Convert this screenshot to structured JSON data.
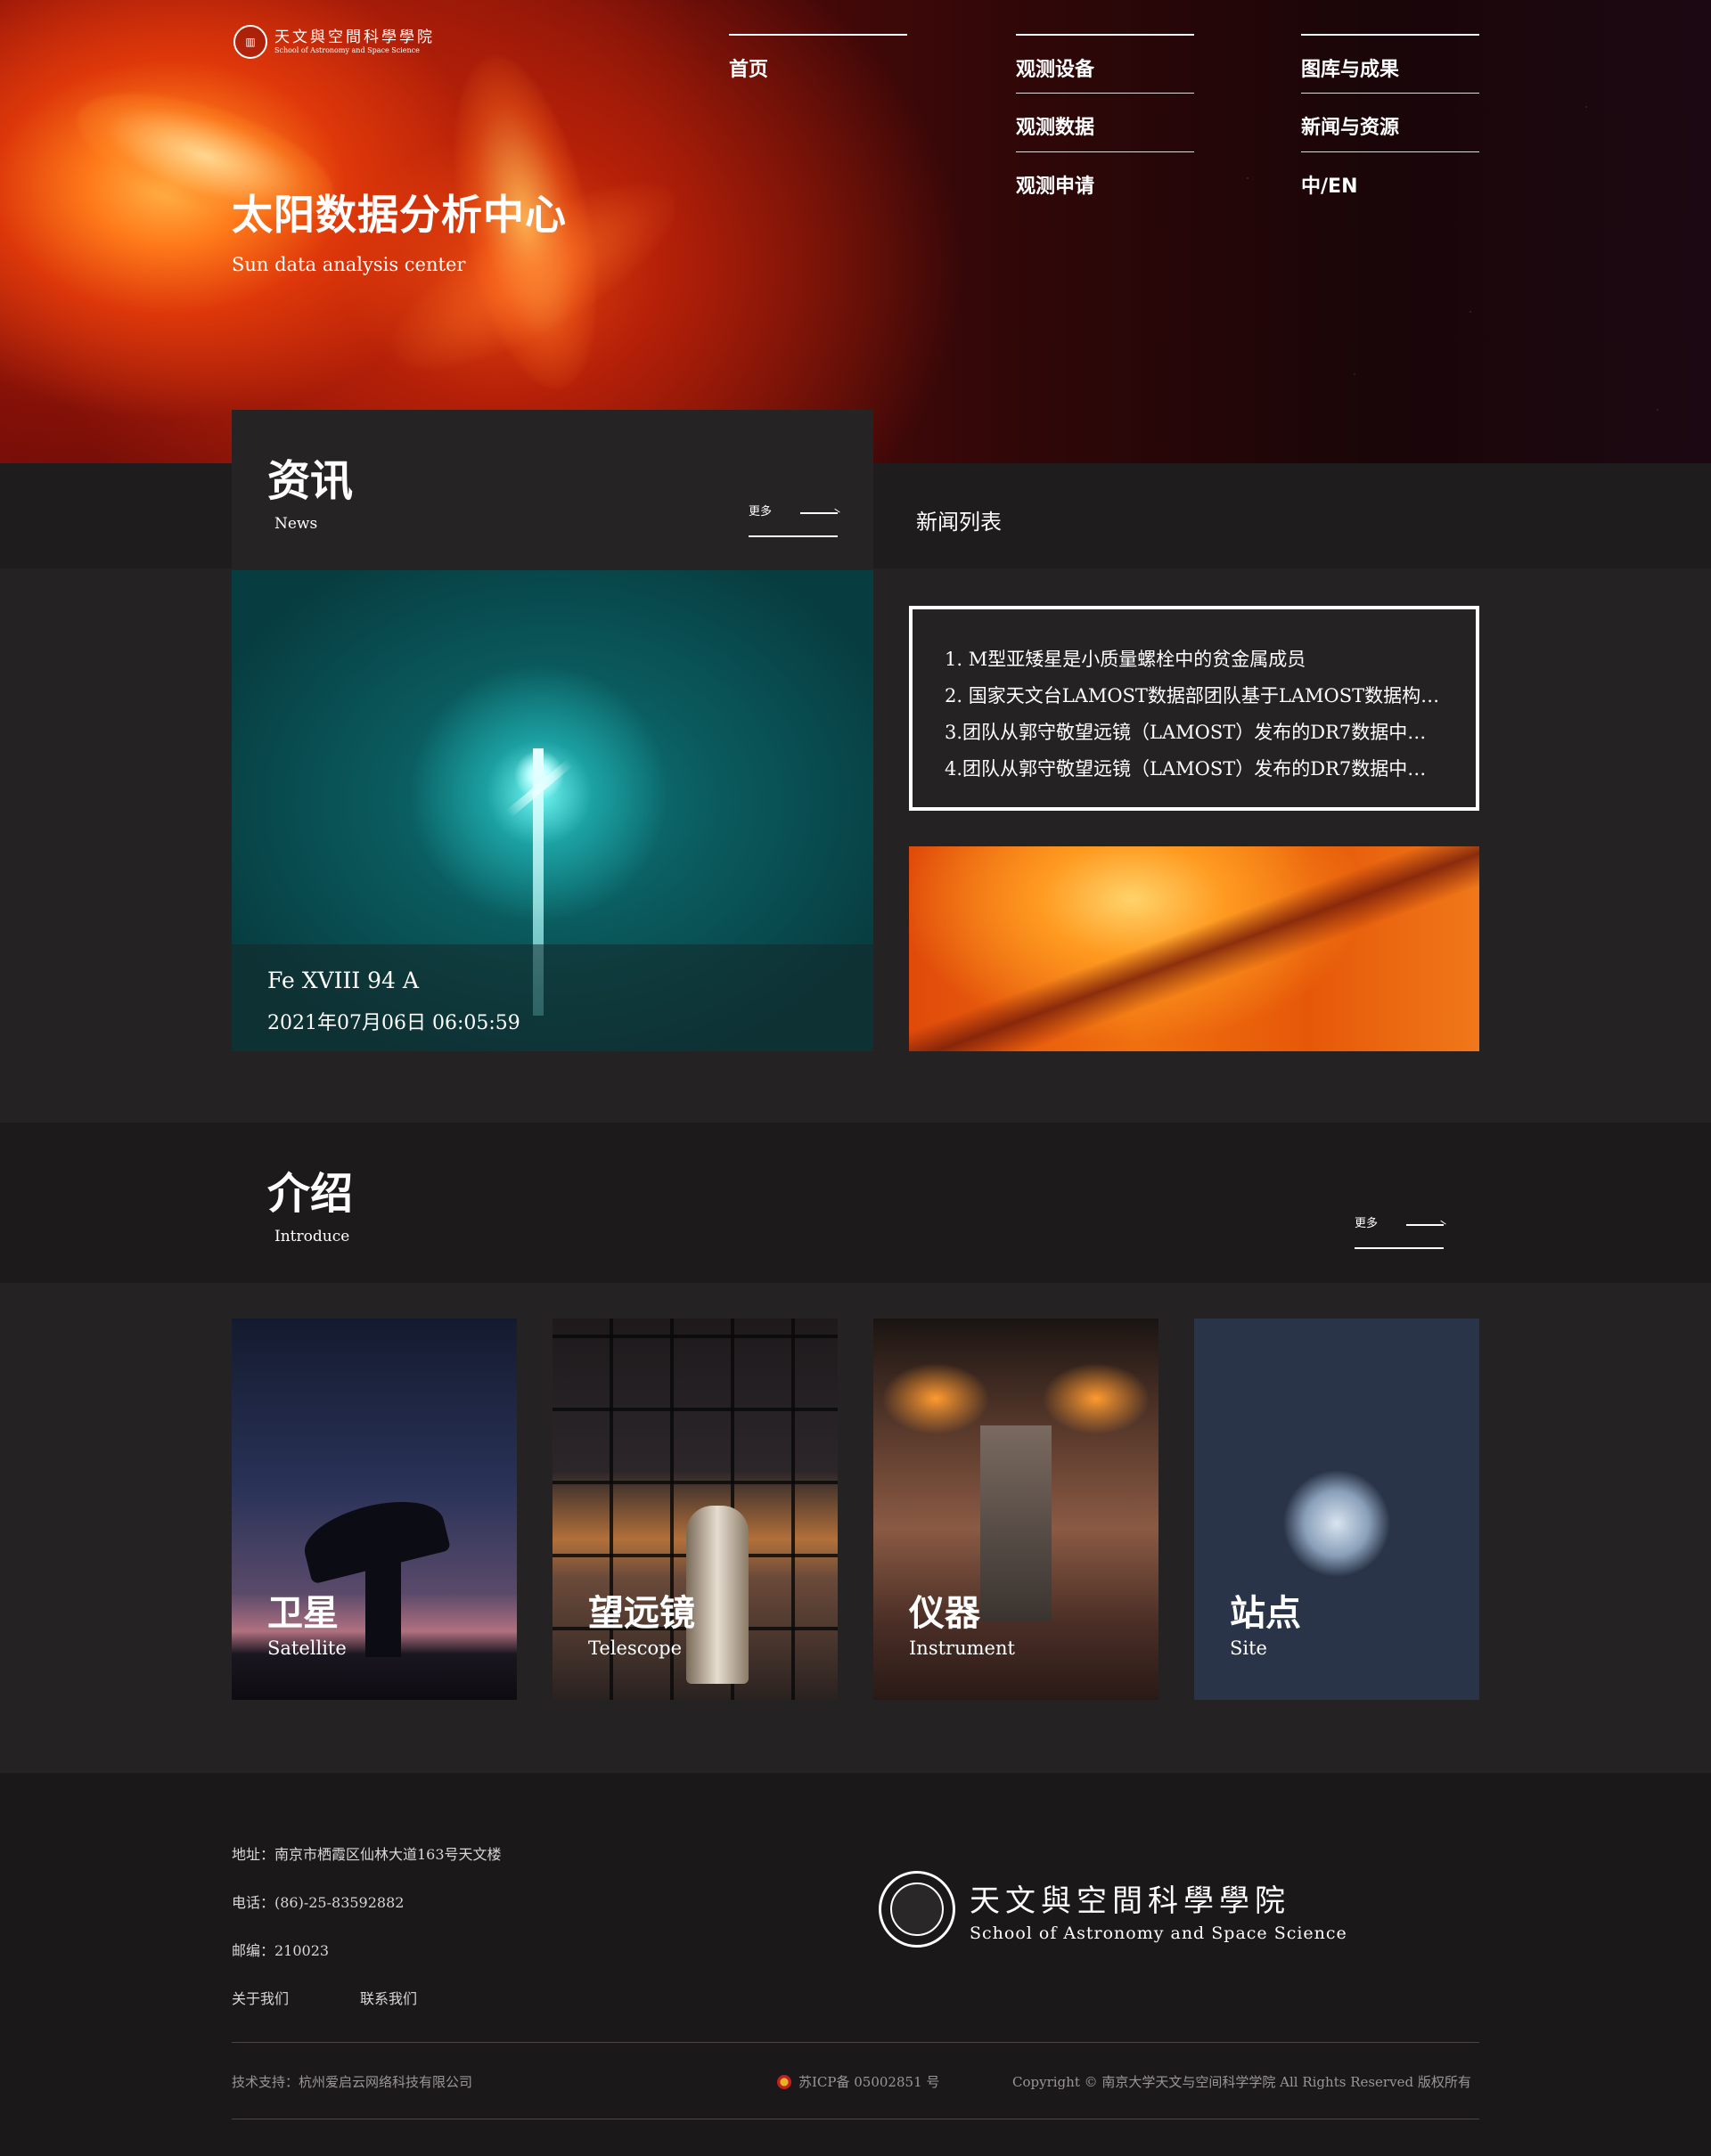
{
  "header": {
    "logo_cn": "天文與空間科學學院",
    "logo_en": "School of Astronomy and Space Science",
    "nav": {
      "col1": [
        "首页"
      ],
      "col2": [
        "观测设备",
        "观测数据",
        "观测申请"
      ],
      "col3": [
        "图库与成果",
        "新闻与资源",
        "中/EN"
      ]
    }
  },
  "hero": {
    "title": "太阳数据分析中心",
    "subtitle": "Sun data analysis center"
  },
  "news": {
    "title": "资讯",
    "subtitle": "News",
    "more_label": "更多",
    "list_label": "新闻列表",
    "photo_caption": "Fe XVIII 94 A",
    "photo_date": "2021年07月06日 06:05:59",
    "items": [
      "1. M型亚矮星是小质量螺栓中的贫金属成员",
      "2. 国家天文台LAMOST数据部团队基于LAMOST数据构建…",
      "3.团队从郭守敬望远镜（LAMOST）发布的DR7数据中分辨…",
      "4.团队从郭守敬望远镜（LAMOST）发布的DR7数据中分辨…"
    ]
  },
  "intro": {
    "title": "介绍",
    "subtitle": "Introduce",
    "more_label": "更多",
    "cards": [
      {
        "cn": "卫星",
        "en": "Satellite"
      },
      {
        "cn": "望远镜",
        "en": "Telescope"
      },
      {
        "cn": "仪器",
        "en": "Instrument"
      },
      {
        "cn": "站点",
        "en": "Site"
      }
    ]
  },
  "footer": {
    "address": "地址：南京市栖霞区仙林大道163号天文楼",
    "phone": "电话：(86)-25-83592882",
    "postcode": "邮编：210023",
    "about": "关于我们",
    "contact": "联系我们",
    "logo_cn": "天文與空間科學學院",
    "logo_en": "School of Astronomy and Space Science",
    "tech_support": "技术支持：杭州爱启云网络科技有限公司",
    "icp": "苏ICP备 05002851 号",
    "copyright": "Copyright © 南京大学天文与空间科学学院 All Rights Reserved 版权所有"
  }
}
